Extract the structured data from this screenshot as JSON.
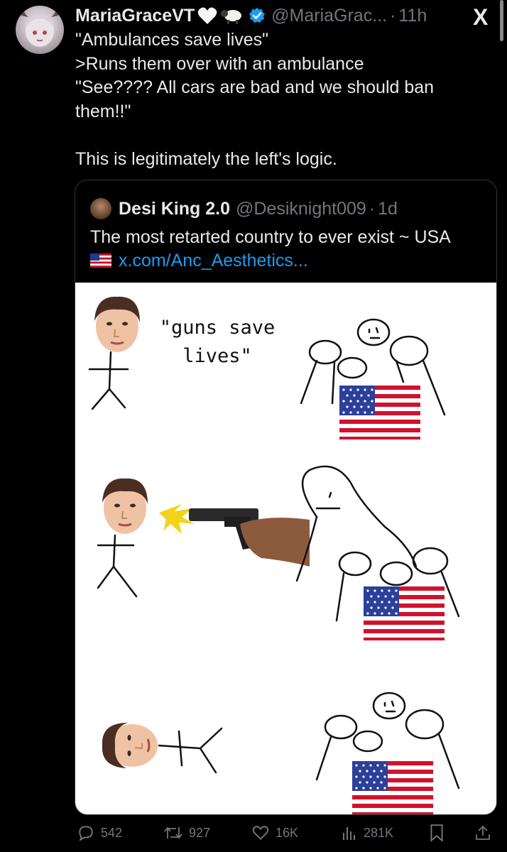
{
  "post": {
    "author_name": "MariaGraceVT",
    "author_badges": [
      "white-heart",
      "sheep"
    ],
    "verified": true,
    "handle": "@MariaGrac...",
    "separator": "·",
    "time": "11h",
    "text_lines": [
      "\"Ambulances save lives\"",
      ">Runs them over with an ambulance",
      "\"See???? All cars are bad and we should ban",
      "them!!\"",
      "",
      "This is legitimately the left's logic."
    ]
  },
  "app": {
    "logo": "X"
  },
  "quoted_post": {
    "author_name": "Desi King 2.0",
    "handle": "@Desiknight009",
    "separator": "·",
    "time": "1d",
    "text": "The most retarted country to ever exist ~ USA",
    "flag_icon": "us-flag-emoji",
    "link": "x.com/Anc_Aesthetics...",
    "meme": {
      "caption_lines": [
        "\"guns save",
        "lives\""
      ]
    }
  },
  "actions": {
    "replies": "542",
    "reposts": "927",
    "likes": "16K",
    "views": "281K"
  },
  "colors": {
    "background": "#000000",
    "text": "#e7e9ea",
    "muted": "#71767b",
    "link": "#1d9bf0",
    "border": "#2f3336"
  }
}
